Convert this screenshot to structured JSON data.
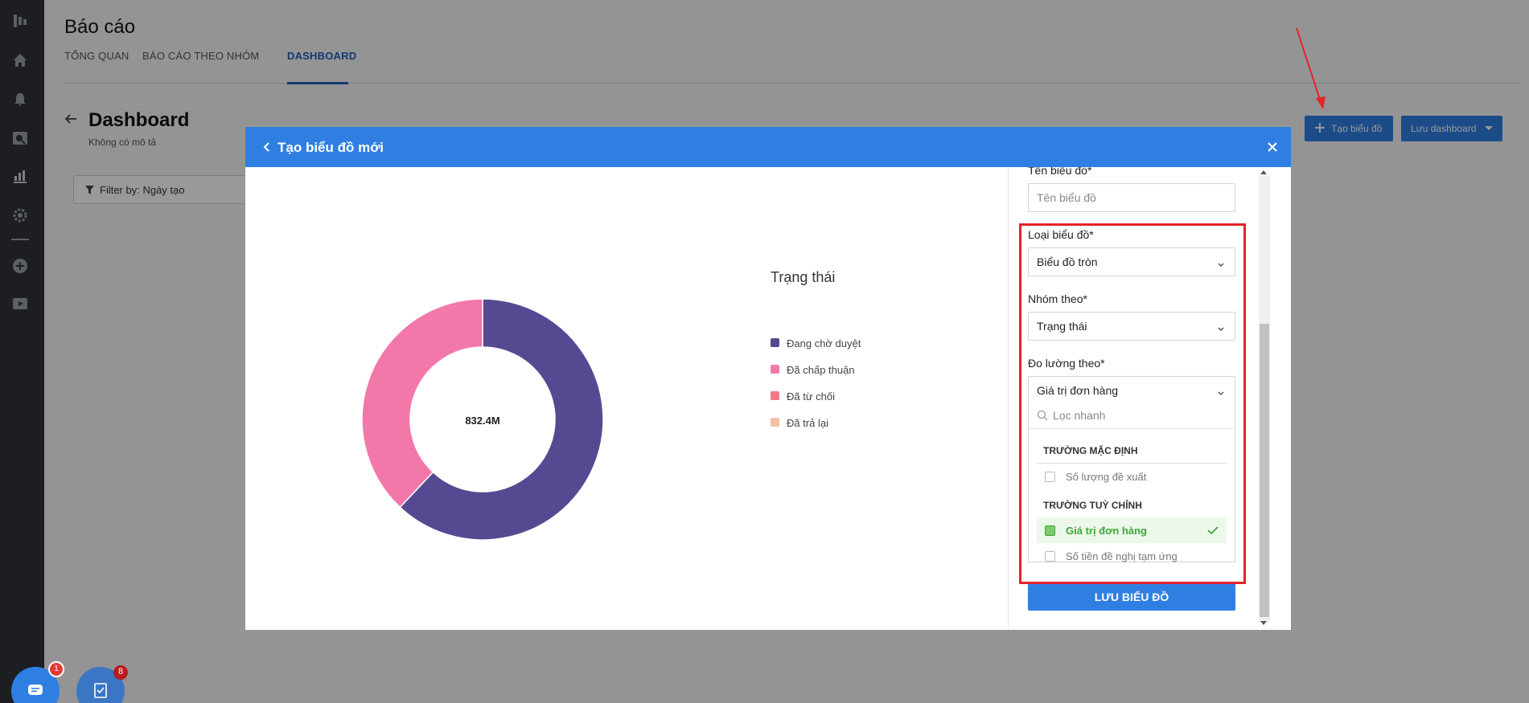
{
  "page": {
    "title": "Báo cáo",
    "tabs": [
      {
        "label": "TỔNG QUAN"
      },
      {
        "label": "BÁO CÁO THEO NHÓM"
      },
      {
        "label": "DASHBOARD"
      }
    ],
    "dashboard_title": "Dashboard",
    "dashboard_description": "Không có mô tả",
    "filter_label": "Filter by: Ngày tạo",
    "create_chart_button": "Tạo biểu đồ",
    "save_dashboard_button": "Lưu dashboard"
  },
  "modal": {
    "title": "Tạo biểu đồ mới",
    "chart_name_label": "Tên biểu đồ*",
    "chart_name_placeholder": "Tên biểu đồ",
    "chart_type_label": "Loại biểu đồ*",
    "chart_type_value": "Biểu đồ tròn",
    "group_by_label": "Nhóm theo*",
    "group_by_value": "Trạng thái",
    "measure_by_label": "Đo lường theo*",
    "measure_by_value": "Giá trị đơn hàng",
    "dropdown": {
      "search_placeholder": "Lọc nhanh",
      "groups": [
        {
          "title": "TRƯỜNG MẶC ĐỊNH",
          "items": [
            {
              "label": "Số lượng đề xuất",
              "selected": false
            }
          ]
        },
        {
          "title": "TRƯỜNG TUỲ CHỈNH",
          "items": [
            {
              "label": "Giá trị đơn hàng",
              "selected": true
            },
            {
              "label": "Số tiền đề nghị tạm ứng",
              "selected": false
            }
          ]
        }
      ]
    },
    "save_button": "LƯU BIỂU ĐỒ"
  },
  "chart_data": {
    "type": "pie",
    "donut": true,
    "center_label": "832.4M",
    "legend_title": "Trạng thái",
    "categories": [
      "Đang chờ duyệt",
      "Đã chấp thuận",
      "Đã từ chối",
      "Đã trả lại"
    ],
    "values": [
      0.62,
      0.38,
      0,
      0
    ],
    "colors": [
      "#554a92",
      "#f278aa",
      "#ee7a83",
      "#f6c0a5"
    ]
  },
  "badges": {
    "chat": "1",
    "tasks": "8"
  },
  "colors": {
    "primary": "#2f7fe3",
    "highlight": "#e5222a",
    "rail": "#2f3338"
  }
}
